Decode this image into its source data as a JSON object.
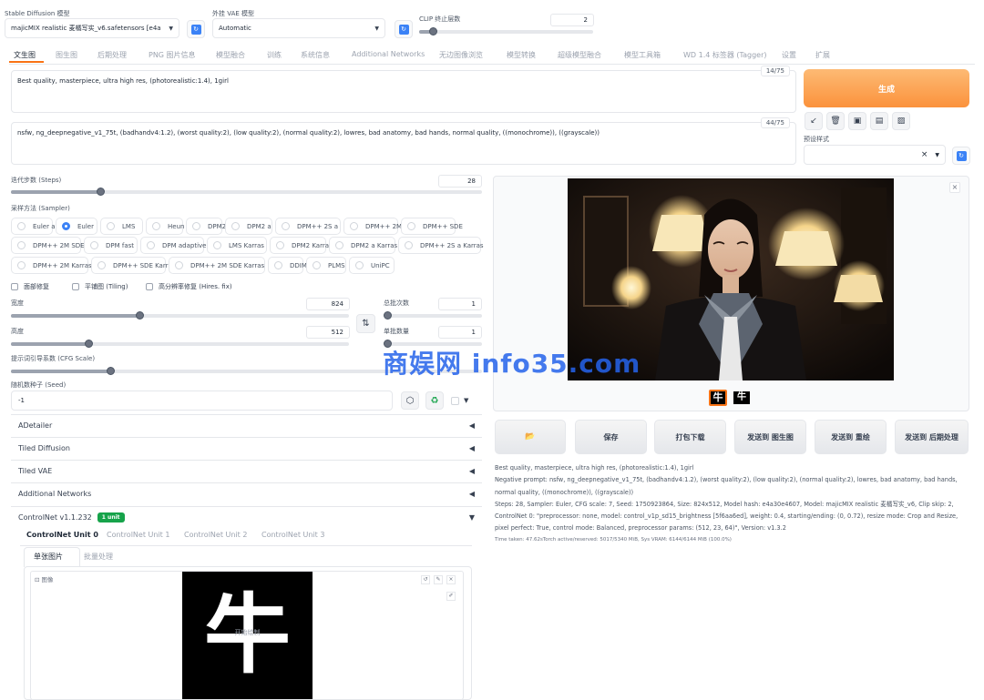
{
  "top": {
    "model_label": "Stable Diffusion 模型",
    "model_value": "majicMIX realistic 麦橘写实_v6.safetensors [e4a",
    "vae_label": "外挂 VAE 模型",
    "vae_value": "Automatic",
    "clip_label": "CLIP 终止层数",
    "clip_value": "2",
    "clip_fraction": 0.08
  },
  "tabs": [
    "文生图",
    "图生图",
    "后期处理",
    "PNG 图片信息",
    "模型融合",
    "训练",
    "系统信息",
    "Additional Networks",
    "无边图像浏览",
    "模型转换",
    "超级模型融合",
    "模型工具箱",
    "WD 1.4 标签器 (Tagger)",
    "设置",
    "扩展"
  ],
  "prompt": {
    "positive": "Best quality, masterpiece, ultra high res, (photorealistic:1.4), 1girl",
    "positive_count": "14/75",
    "negative": "nsfw, ng_deepnegative_v1_75t, (badhandv4:1.2), (worst quality:2), (low quality:2), (normal quality:2), lowres, bad anatomy, bad hands, normal quality, ((monochrome)), ((grayscale))",
    "negative_count": "44/75"
  },
  "generate_label": "生成",
  "style_label": "预设样式",
  "style_clear": "×",
  "tool_icons": [
    "arrow-icon",
    "trash-icon",
    "paint-icon",
    "paste-icon",
    "save-style-icon"
  ],
  "tool_glyphs": [
    "↙",
    "🗑",
    "▣",
    "▤",
    "▨"
  ],
  "steps": {
    "label": "迭代步数 (Steps)",
    "value": "28",
    "fraction": 0.19
  },
  "sampler": {
    "label": "采样方法 (Sampler)",
    "selected": "Euler",
    "options": [
      "Euler a",
      "Euler",
      "LMS",
      "Heun",
      "DPM2",
      "DPM2 a",
      "DPM++ 2S a",
      "DPM++ 2M",
      "DPM++ SDE",
      "DPM++ 2M SDE",
      "DPM fast",
      "DPM adaptive",
      "LMS Karras",
      "DPM2 Karras",
      "DPM2 a Karras",
      "DPM++ 2S a Karras",
      "DPM++ 2M Karras",
      "DPM++ SDE Karras",
      "DPM++ 2M SDE Karras",
      "DDIM",
      "PLMS",
      "UniPC"
    ]
  },
  "checks": {
    "restore_faces": "面部修复",
    "tiling": "平铺图 (Tiling)",
    "hires": "高分辨率修复 (Hires. fix)"
  },
  "width": {
    "label": "宽度",
    "value": "824",
    "fraction": 0.38
  },
  "height": {
    "label": "高度",
    "value": "512",
    "fraction": 0.23
  },
  "swap_glyph": "⇅",
  "batch_count": {
    "label": "总批次数",
    "value": "1",
    "fraction": 0.0
  },
  "batch_size": {
    "label": "单批数量",
    "value": "1",
    "fraction": 0.0
  },
  "cfg": {
    "label": "提示词引导系数 (CFG Scale)",
    "fraction": 0.21
  },
  "seed": {
    "label": "随机数种子 (Seed)",
    "value": "-1"
  },
  "seed_extra_arrow": "▼",
  "accordions": [
    {
      "label": "ADetailer",
      "arrow": "◀"
    },
    {
      "label": "Tiled Diffusion",
      "arrow": "◀"
    },
    {
      "label": "Tiled VAE",
      "arrow": "◀"
    },
    {
      "label": "Additional Networks",
      "arrow": "◀"
    }
  ],
  "controlnet": {
    "title": "ControlNet v1.1.232",
    "badge": "1 unit",
    "arrow": "▼",
    "units": [
      "ControlNet Unit 0",
      "ControlNet Unit 1",
      "ControlNet Unit 2",
      "ControlNet Unit 3"
    ],
    "subtabs": [
      "单张图片",
      "批量处理"
    ],
    "image_label": "图像",
    "image_char": "牛",
    "image_hint": "开始绘制"
  },
  "result": {
    "close": "×",
    "thumb_char": "牛",
    "buttons": [
      "保存",
      "打包下载",
      "发送到 图生图",
      "发送到 重绘",
      "发送到 后期处理"
    ],
    "folder_icon": "📂",
    "info_lines": [
      "Best quality, masterpiece, ultra high res, (photorealistic:1.4), 1girl",
      "Negative prompt: nsfw, ng_deepnegative_v1_75t, (badhandv4:1.2), (worst quality:2), (low quality:2), (normal quality:2), lowres, bad anatomy, bad hands,",
      "normal quality, ((monochrome)), ((grayscale))",
      "Steps: 28, Sampler: Euler, CFG scale: 7, Seed: 1750923864, Size: 824x512, Model hash: e4a30e4607, Model: majicMIX realistic 麦橘写实_v6, Clip skip: 2,",
      "ControlNet 0: \"preprocessor: none, model: control_v1p_sd15_brightness [5f6aa6ed], weight: 0.4, starting/ending: (0, 0.72), resize mode: Crop and Resize,",
      "pixel perfect: True, control mode: Balanced, preprocessor params: (512, 23, 64)\", Version: v1.3.2"
    ],
    "time_text": "Time taken: 47.62sTorch active/reserved: 5017/5340 MiB, Sys VRAM: 6144/6144 MiB (100.0%)"
  },
  "watermark": "商娱网 info35.com"
}
